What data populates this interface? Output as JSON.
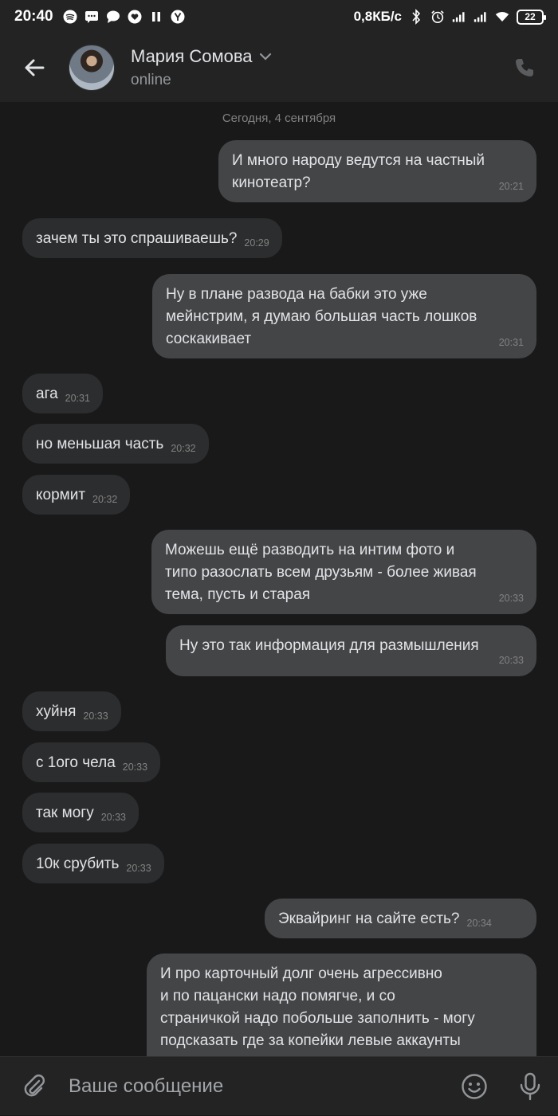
{
  "status_bar": {
    "time": "20:40",
    "net_speed": "0,8КБ/с",
    "battery": "22",
    "icons_left": [
      "spotify-icon",
      "message-icon",
      "chat-icon",
      "heart-icon",
      "pause-icon",
      "yandex-icon"
    ],
    "icons_right": [
      "bluetooth-icon",
      "alarm-icon",
      "signal-icon",
      "signal-icon",
      "wifi-icon",
      "battery-icon"
    ]
  },
  "header": {
    "contact_name": "Мария Сомова",
    "status": "online"
  },
  "chat": {
    "date_separator": "Сегодня, 4 сентября",
    "messages": [
      {
        "dir": "out",
        "text": "И много народу ведутся на частный\nкинотеатр?",
        "time": "20:21"
      },
      {
        "dir": "in",
        "text": "зачем ты это спрашиваешь?",
        "time": "20:29"
      },
      {
        "dir": "out",
        "text": "Ну в плане развода на бабки это уже\nмейнстрим, я думаю большая часть лошков\nсоскакивает",
        "time": "20:31"
      },
      {
        "dir": "in",
        "text": "ага",
        "time": "20:31"
      },
      {
        "dir": "in",
        "text": "но меньшая часть",
        "time": "20:32"
      },
      {
        "dir": "in",
        "text": "кормит",
        "time": "20:32"
      },
      {
        "dir": "out",
        "text": "Можешь ещё разводить на интим фото и\nтипо разослать всем друзьям - более живая\nтема, пусть и старая",
        "time": "20:33"
      },
      {
        "dir": "out",
        "text": "Ну это так информация для размышления",
        "time": "20:33"
      },
      {
        "dir": "in",
        "text": "хуйня",
        "time": "20:33"
      },
      {
        "dir": "in",
        "text": "с 1ого чела",
        "time": "20:33"
      },
      {
        "dir": "in",
        "text": "так могу",
        "time": "20:33"
      },
      {
        "dir": "in",
        "text": "10к срубить",
        "time": "20:33"
      },
      {
        "dir": "out",
        "text": "Эквайринг на сайте есть?",
        "time": "20:34"
      },
      {
        "dir": "out",
        "text": "И про карточный долг очень агрессивно\nи по пацански надо помягче, и со\nстраничкой надо побольше заполнить - могу\nподсказать где за копейки левые аккаунты",
        "time": ""
      }
    ]
  },
  "input": {
    "placeholder": "Ваше сообщение"
  },
  "colors": {
    "background": "#19191a",
    "bar": "#232324",
    "bubble_in": "#2c2d2e",
    "bubble_out": "#444547",
    "text": "#e1e3e6",
    "muted": "#828282"
  }
}
